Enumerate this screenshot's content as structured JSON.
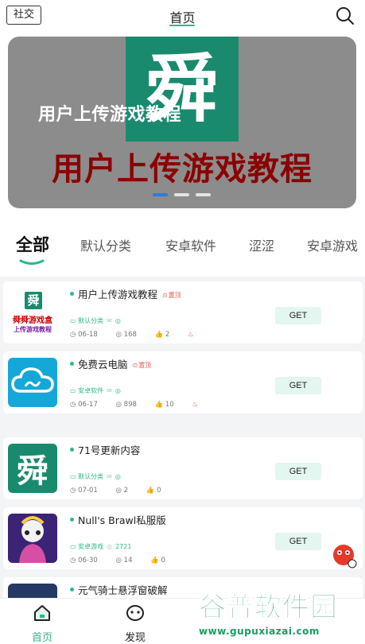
{
  "header": {
    "social_label": "社交",
    "title": "首页",
    "search_icon": "search-icon"
  },
  "banner": {
    "logo_char": "舜",
    "caption": "用户上传游戏教程",
    "big_text": "用户上传游戏教程",
    "slide_count": 3,
    "active_slide": 1,
    "colors": {
      "logo_bg": "#1a8a6e",
      "big_text": "#8b0000",
      "active_dot": "#2f7bd8"
    }
  },
  "tabs": [
    {
      "label": "全部",
      "active": true
    },
    {
      "label": "默认分类"
    },
    {
      "label": "安卓软件"
    },
    {
      "label": "涩涩"
    },
    {
      "label": "安卓游戏"
    }
  ],
  "cards": [
    {
      "name": "用户上传游戏教程",
      "tag": "置顶",
      "category": "默认分类",
      "date": "06-18",
      "views": "168",
      "likes": "2",
      "hot": true,
      "icon_line1": "舜舜游戏盒",
      "icon_line2": "上传游戏教程",
      "get": "GET"
    },
    {
      "name": "免费云电脑",
      "tag": "置顶",
      "category": "安卓软件",
      "date": "06-17",
      "views": "898",
      "likes": "10",
      "hot": true,
      "get": "GET"
    },
    {
      "name": "71号更新内容",
      "category": "默认分类",
      "date": "07-01",
      "views": "2",
      "likes": "0",
      "get": "GET"
    },
    {
      "name": "Null's Brawl私服版",
      "category": "安卓游戏",
      "extra": "2721",
      "date": "06-30",
      "views": "14",
      "likes": "0",
      "get": "GET"
    },
    {
      "name": "元气骑士悬浮窗破解"
    }
  ],
  "bottom_nav": [
    {
      "label": "首页",
      "icon": "home-icon",
      "active": true
    },
    {
      "label": "发现",
      "icon": "discover-icon"
    }
  ],
  "watermark": {
    "title": "谷普软件园",
    "url": "www.gupuxiazai.com"
  }
}
